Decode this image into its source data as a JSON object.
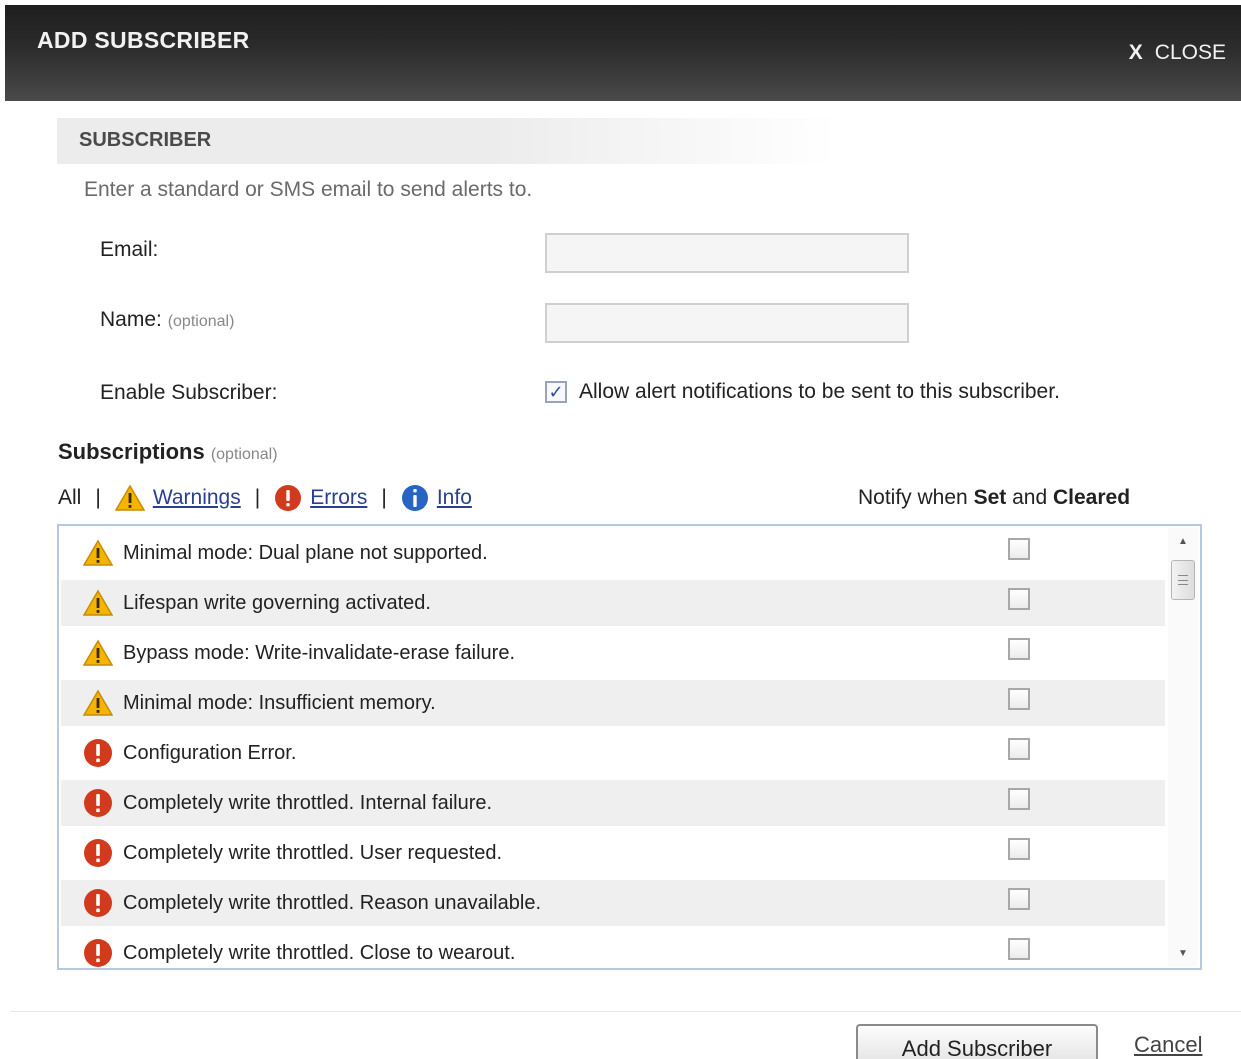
{
  "dialog": {
    "title": "ADD SUBSCRIBER",
    "close_label": "CLOSE",
    "close_icon": "x-icon",
    "close_glyph": "X"
  },
  "subscriber": {
    "section_title": "SUBSCRIBER",
    "intro": "Enter a standard or SMS email to send alerts to.",
    "email_label": "Email:",
    "email_value": "",
    "name_label": "Name:",
    "name_optional": "(optional)",
    "name_value": "",
    "enable_label": "Enable Subscriber:",
    "enable_checked": true,
    "enable_text": "Allow alert notifications to be sent to this subscriber."
  },
  "subscriptions": {
    "heading": "Subscriptions",
    "heading_optional": "(optional)",
    "filters": {
      "all": "All",
      "separator": "|",
      "warnings": "Warnings",
      "errors": "Errors",
      "info": "Info"
    },
    "notify_prefix": "Notify when",
    "notify_set": "Set",
    "notify_and": "and",
    "notify_cleared": "Cleared",
    "items": [
      {
        "type": "warning",
        "text": "Minimal mode: Dual plane not supported.",
        "checked": false
      },
      {
        "type": "warning",
        "text": "Lifespan write governing activated.",
        "checked": false
      },
      {
        "type": "warning",
        "text": "Bypass mode: Write-invalidate-erase failure.",
        "checked": false
      },
      {
        "type": "warning",
        "text": "Minimal mode: Insufficient memory.",
        "checked": false
      },
      {
        "type": "error",
        "text": "Configuration Error.",
        "checked": false
      },
      {
        "type": "error",
        "text": "Completely write throttled. Internal failure.",
        "checked": false
      },
      {
        "type": "error",
        "text": "Completely write throttled. User requested.",
        "checked": false
      },
      {
        "type": "error",
        "text": "Completely write throttled. Reason unavailable.",
        "checked": false
      },
      {
        "type": "error",
        "text": "Completely write throttled. Close to wearout.",
        "checked": false
      }
    ]
  },
  "footer": {
    "add_button": "Add Subscriber",
    "cancel_link": "Cancel"
  },
  "colors": {
    "warning": "#f4b400",
    "error": "#d23a1e",
    "info": "#2764c4",
    "link": "#2a3f8f"
  }
}
